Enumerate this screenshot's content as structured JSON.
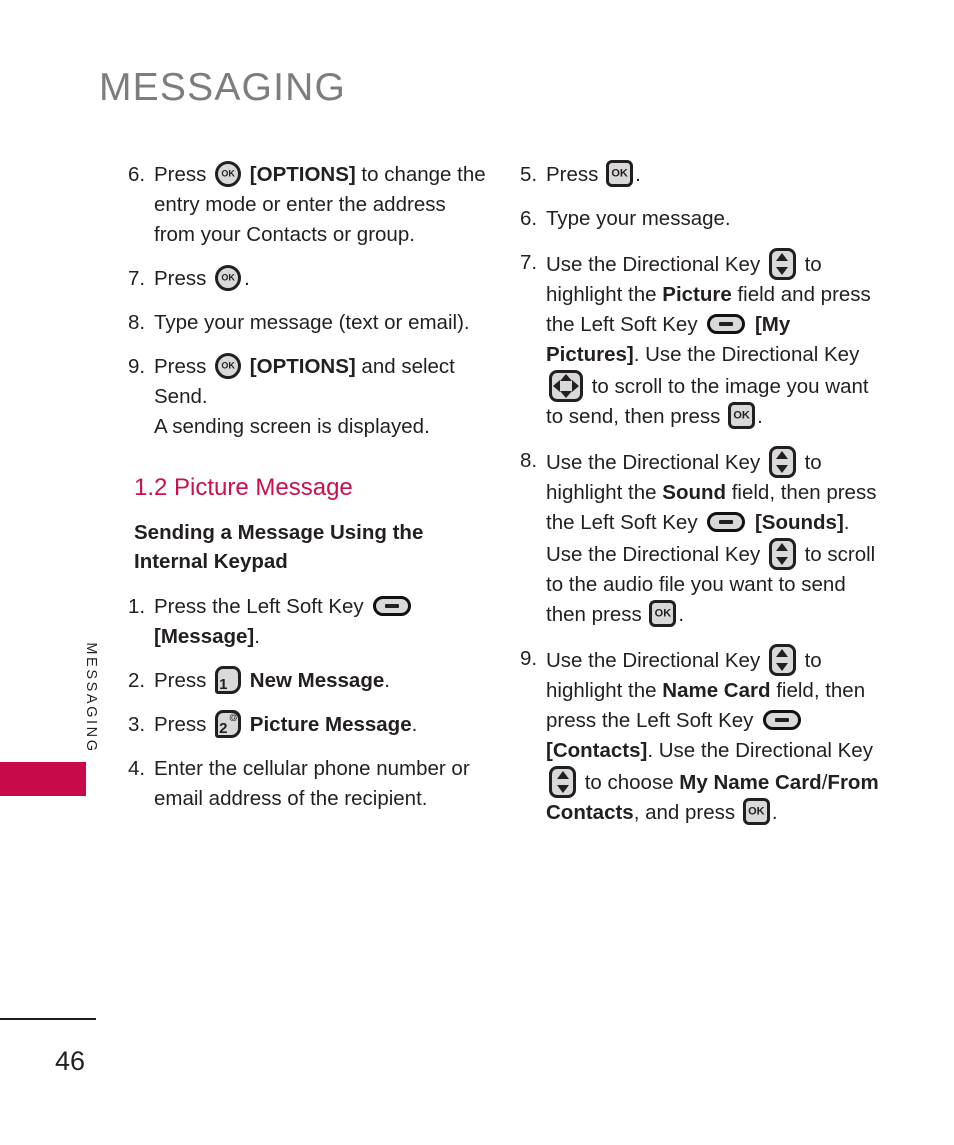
{
  "page": {
    "title": "MESSAGING",
    "side_tab_label": "MESSAGING",
    "page_number": "46",
    "accent_color": "#c80a4b",
    "heading_color": "#cc0f4c",
    "title_color": "#7d7d7d",
    "text_color": "#231f20"
  },
  "icons": {
    "ok_round": "ok-round-icon",
    "ok_square": "ok-square-icon",
    "soft_key": "left-soft-key-icon",
    "key_1": "keypad-key-1-icon",
    "key_2": "keypad-key-2-icon",
    "dkey_vertical": "directional-key-vertical-icon",
    "dkey_4way": "directional-key-4way-icon",
    "ok_label": "OK",
    "key_1_digit": "1",
    "key_1_sup": "'",
    "key_2_digit": "2",
    "key_2_sup": "@"
  },
  "left_column": {
    "steps": [
      {
        "number": "6.",
        "parts": [
          {
            "type": "text",
            "value": "Press "
          },
          {
            "type": "icon",
            "value": "ok-round"
          },
          {
            "type": "bold",
            "value": " [OPTIONS]"
          },
          {
            "type": "text",
            "value": " to change the entry mode or enter the address from your Contacts or group."
          }
        ]
      },
      {
        "number": "7.",
        "parts": [
          {
            "type": "text",
            "value": "Press "
          },
          {
            "type": "icon",
            "value": "ok-round"
          },
          {
            "type": "text",
            "value": "."
          }
        ]
      },
      {
        "number": "8.",
        "parts": [
          {
            "type": "text",
            "value": "Type your message (text or email)."
          }
        ]
      },
      {
        "number": "9.",
        "parts": [
          {
            "type": "text",
            "value": "Press "
          },
          {
            "type": "icon",
            "value": "ok-round"
          },
          {
            "type": "bold",
            "value": " [OPTIONS]"
          },
          {
            "type": "text",
            "value": " and select Send."
          },
          {
            "type": "break",
            "value": ""
          },
          {
            "type": "text",
            "value": "A sending screen is displayed."
          }
        ]
      }
    ],
    "section_heading": "1.2 Picture Message",
    "sub_heading": "Sending a Message Using the Internal Keypad",
    "steps2": [
      {
        "number": "1.",
        "parts": [
          {
            "type": "text",
            "value": "Press the Left Soft Key "
          },
          {
            "type": "icon",
            "value": "softkey"
          },
          {
            "type": "bold",
            "value": " [Message]"
          },
          {
            "type": "text",
            "value": "."
          }
        ]
      },
      {
        "number": "2.",
        "parts": [
          {
            "type": "text",
            "value": "Press "
          },
          {
            "type": "icon",
            "value": "key-1"
          },
          {
            "type": "bold",
            "value": " New Message"
          },
          {
            "type": "text",
            "value": "."
          }
        ]
      },
      {
        "number": "3.",
        "parts": [
          {
            "type": "text",
            "value": "Press "
          },
          {
            "type": "icon",
            "value": "key-2"
          },
          {
            "type": "bold",
            "value": " Picture Message"
          },
          {
            "type": "text",
            "value": "."
          }
        ]
      },
      {
        "number": "4.",
        "parts": [
          {
            "type": "text",
            "value": "Enter the cellular phone number or email address of the recipient."
          }
        ]
      }
    ]
  },
  "right_column": {
    "steps": [
      {
        "number": "5.",
        "parts": [
          {
            "type": "text",
            "value": "Press "
          },
          {
            "type": "icon",
            "value": "ok-square"
          },
          {
            "type": "text",
            "value": "."
          }
        ]
      },
      {
        "number": "6.",
        "parts": [
          {
            "type": "text",
            "value": "Type your message."
          }
        ]
      },
      {
        "number": "7.",
        "parts": [
          {
            "type": "text",
            "value": "Use the Directional Key "
          },
          {
            "type": "icon",
            "value": "dkey-v"
          },
          {
            "type": "text",
            "value": " to highlight the "
          },
          {
            "type": "bold",
            "value": "Picture"
          },
          {
            "type": "text",
            "value": " field and press the Left Soft Key "
          },
          {
            "type": "icon",
            "value": "softkey"
          },
          {
            "type": "bold",
            "value": " [My Pictures]"
          },
          {
            "type": "text",
            "value": ". Use the Directional Key "
          },
          {
            "type": "icon",
            "value": "dkey-4"
          },
          {
            "type": "text",
            "value": " to scroll to the image you want to send, then press "
          },
          {
            "type": "icon",
            "value": "ok-square"
          },
          {
            "type": "text",
            "value": "."
          }
        ]
      },
      {
        "number": "8.",
        "parts": [
          {
            "type": "text",
            "value": "Use the Directional Key "
          },
          {
            "type": "icon",
            "value": "dkey-v"
          },
          {
            "type": "text",
            "value": " to highlight the "
          },
          {
            "type": "bold",
            "value": "Sound"
          },
          {
            "type": "text",
            "value": " field, then press the Left Soft Key "
          },
          {
            "type": "icon",
            "value": "softkey"
          },
          {
            "type": "bold",
            "value": " [Sounds]"
          },
          {
            "type": "text",
            "value": ". Use the Directional Key "
          },
          {
            "type": "icon",
            "value": "dkey-v"
          },
          {
            "type": "text",
            "value": " to scroll to the audio file you want to send then press "
          },
          {
            "type": "icon",
            "value": "ok-square"
          },
          {
            "type": "text",
            "value": "."
          }
        ]
      },
      {
        "number": "9.",
        "parts": [
          {
            "type": "text",
            "value": "Use the Directional Key "
          },
          {
            "type": "icon",
            "value": "dkey-v"
          },
          {
            "type": "text",
            "value": " to highlight the "
          },
          {
            "type": "bold",
            "value": "Name Card"
          },
          {
            "type": "text",
            "value": " field, then press the Left Soft Key "
          },
          {
            "type": "icon",
            "value": "softkey"
          },
          {
            "type": "bold",
            "value": " [Contacts]"
          },
          {
            "type": "text",
            "value": ". Use the Directional Key "
          },
          {
            "type": "icon",
            "value": "dkey-v"
          },
          {
            "type": "text",
            "value": " to choose "
          },
          {
            "type": "bold",
            "value": "My Name Card"
          },
          {
            "type": "text",
            "value": "/"
          },
          {
            "type": "bold",
            "value": "From Contacts"
          },
          {
            "type": "text",
            "value": ", and press "
          },
          {
            "type": "icon",
            "value": "ok-square"
          },
          {
            "type": "text",
            "value": "."
          }
        ]
      }
    ]
  }
}
